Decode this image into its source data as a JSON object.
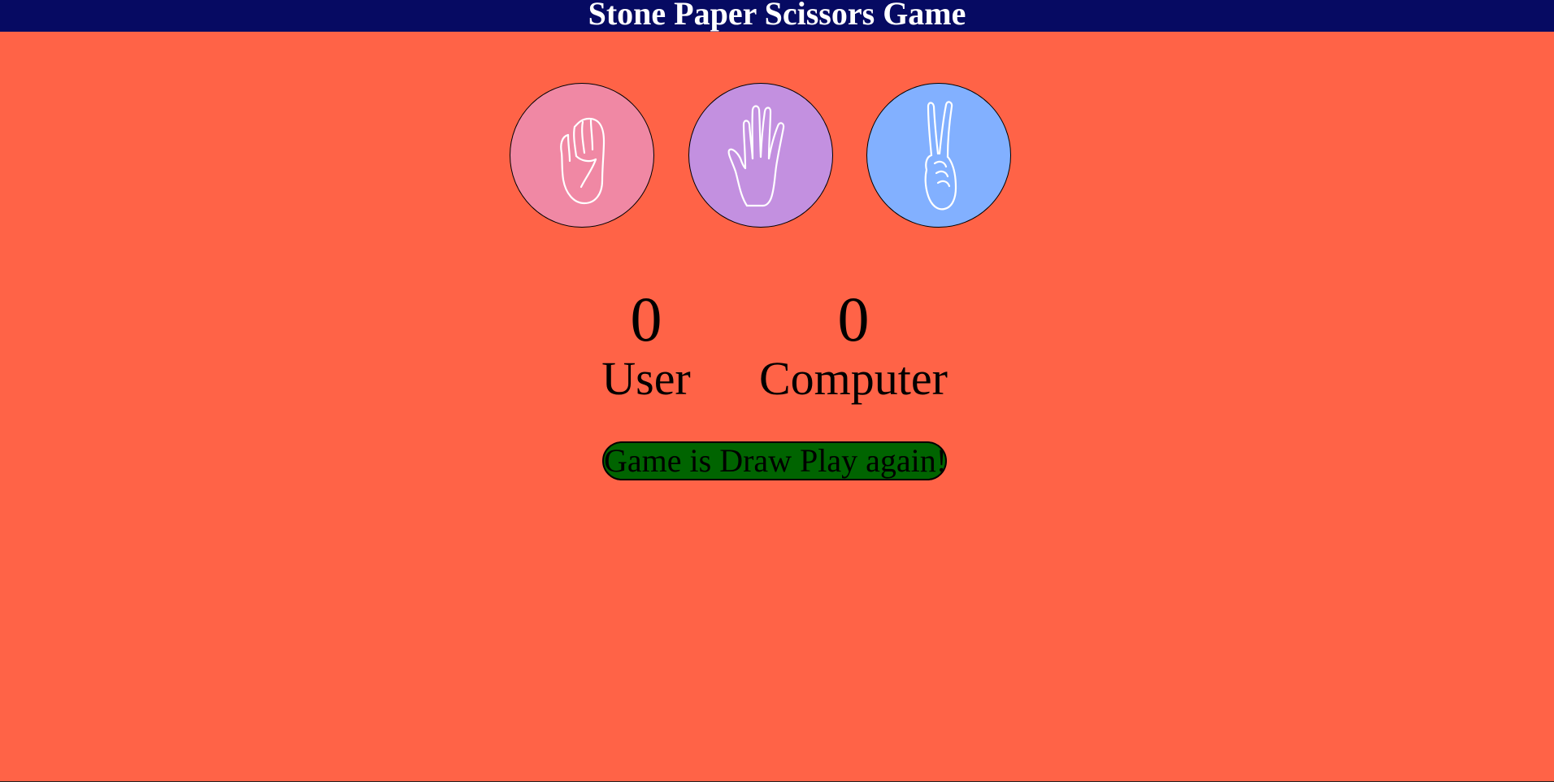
{
  "header": {
    "title": "Stone Paper Scissors Game"
  },
  "choices": [
    {
      "name": "stone",
      "icon": "fist-icon",
      "color": "#f088a4"
    },
    {
      "name": "paper",
      "icon": "open-hand-icon",
      "color": "#c390e0"
    },
    {
      "name": "scissors",
      "icon": "peace-sign-icon",
      "color": "#82b0ff"
    }
  ],
  "scoreboard": {
    "user_score": "0",
    "user_label": "User",
    "computer_score": "0",
    "computer_label": "Computer"
  },
  "message": {
    "text": "Game is Draw Play again!",
    "color": "#006400"
  },
  "colors": {
    "background": "#ff6347",
    "header": "#060a62"
  }
}
